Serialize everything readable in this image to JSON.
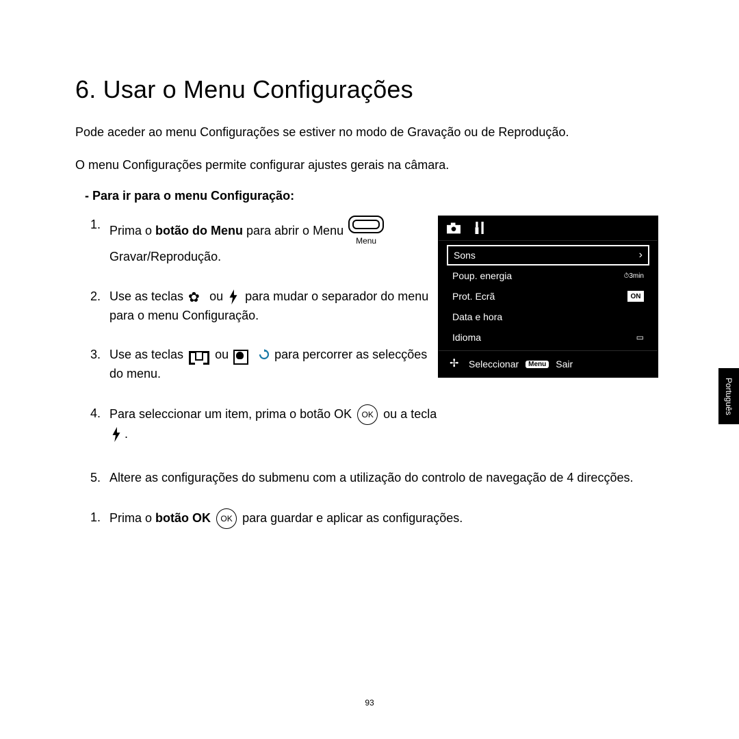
{
  "title": "6. Usar o Menu Configurações",
  "intro1": "Pode aceder ao menu Configurações se estiver no modo de Gravação ou de Reprodução.",
  "intro2": "O menu Configurações permite configurar ajustes gerais na câmara.",
  "subheading": "- Para ir para o menu Configuração:",
  "menu_label": "Menu",
  "step1_a": "Prima o ",
  "step1_b": "botão do Menu",
  "step1_c": " para abrir o Menu ",
  "step1_d": "Gravar/Reprodução.",
  "step2_a": "Use as teclas ",
  "step2_b": " ou ",
  "step2_c": " para mudar o separador do menu para o menu Configuração.",
  "step3_a": "Use as teclas ",
  "step3_b": " ou ",
  "step3_c": " para percorrer as selecções do menu.",
  "step4_a": "Para seleccionar um item, prima o botão OK ",
  "step4_b": " ou a tecla ",
  "step4_c": ".",
  "ok_label": "OK",
  "step5": "Altere as configurações do submenu com a utilização do controlo de navegação de 4 direcções.",
  "step6_a": "Prima o ",
  "step6_b": "botão OK",
  "step6_c": " para guardar e aplicar as configurações.",
  "screen": {
    "items": [
      {
        "label": "Sons",
        "right": "›"
      },
      {
        "label": "Poup. energia",
        "right": "3min"
      },
      {
        "label": "Prot. Ecrã",
        "right": "ON"
      },
      {
        "label": "Data e hora",
        "right": ""
      },
      {
        "label": "Idioma",
        "right": ""
      }
    ],
    "select": "Seleccionar",
    "menuchip": "Menu",
    "exit": "Sair"
  },
  "lang_tab": "Português",
  "page_number": "93"
}
